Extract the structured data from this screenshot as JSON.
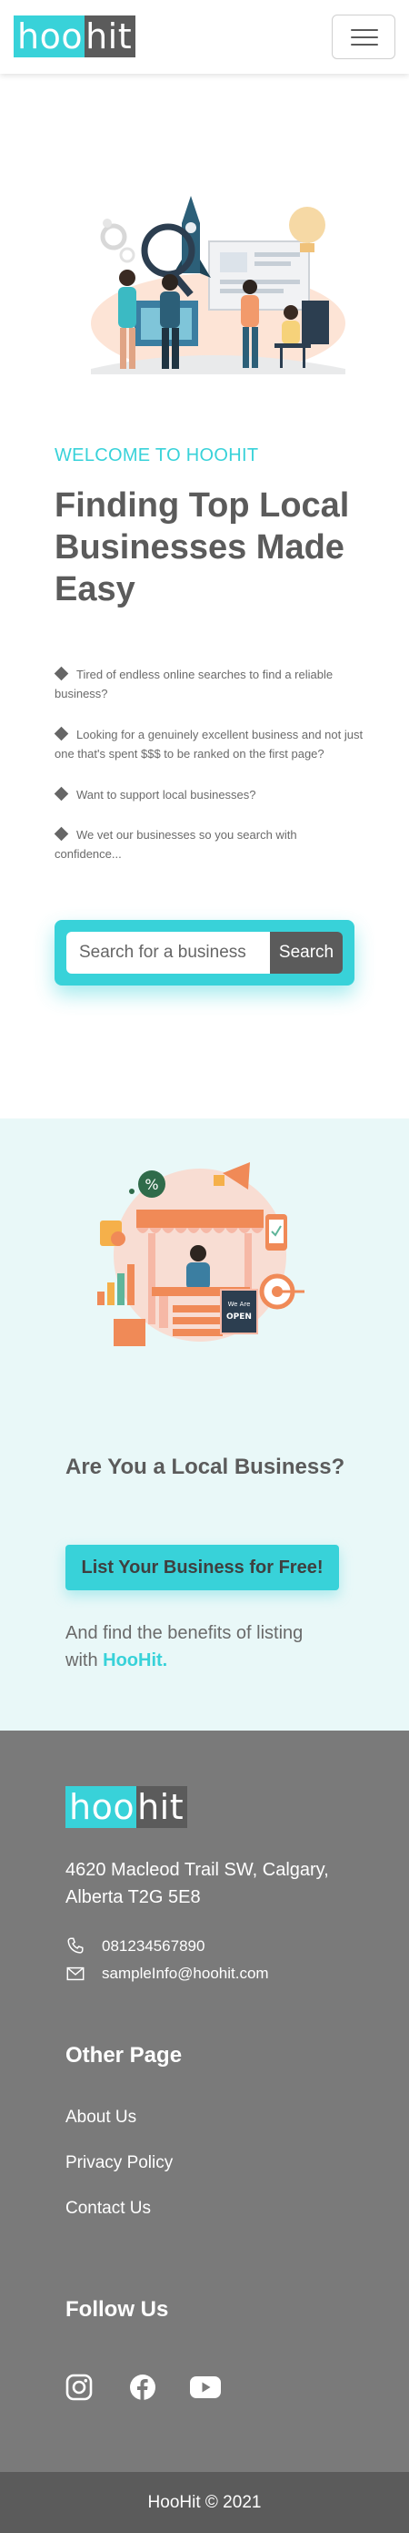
{
  "navbar": {
    "logo_part1": "hoo",
    "logo_part2": "hit",
    "menu_icon": "hamburger-icon"
  },
  "hero": {
    "welcome": "WELCOME TO HOOHIT",
    "title": "Finding Top Local Businesses Made Easy",
    "bullets": [
      "Tired of endless online searches to find a reliable business?",
      "Looking for a genuinely excellent business and not just one that's spent $$$ to be ranked on the first page?",
      "Want to support local businesses?",
      "We vet our businesses so you search with confidence..."
    ],
    "search": {
      "placeholder": "Search for a business",
      "button": "Search"
    }
  },
  "business": {
    "title": "Are You a Local Business?",
    "button": "List Your Business for Free!",
    "benefit_text": "And find the benefits of listing with",
    "benefit_brand": "HooHit.",
    "sign_line1": "We Are",
    "sign_line2": "OPEN"
  },
  "footer": {
    "logo_part1": "hoo",
    "logo_part2": "hit",
    "address": "4620 Macleod Trail SW, Calgary, Alberta T2G 5E8",
    "phone": "081234567890",
    "email": "sampleInfo@hoohit.com",
    "other_heading": "Other Page",
    "links": [
      "About Us",
      "Privacy Policy",
      "Contact Us"
    ],
    "follow_heading": "Follow Us",
    "social_icons": [
      "instagram-icon",
      "facebook-icon",
      "youtube-icon"
    ],
    "copyright": "HooHit © 2021"
  },
  "colors": {
    "accent": "#38d2d9",
    "dark": "#5b5b5b",
    "footer_bg": "#7a7a7a",
    "section_bg": "#e9f8f8"
  }
}
